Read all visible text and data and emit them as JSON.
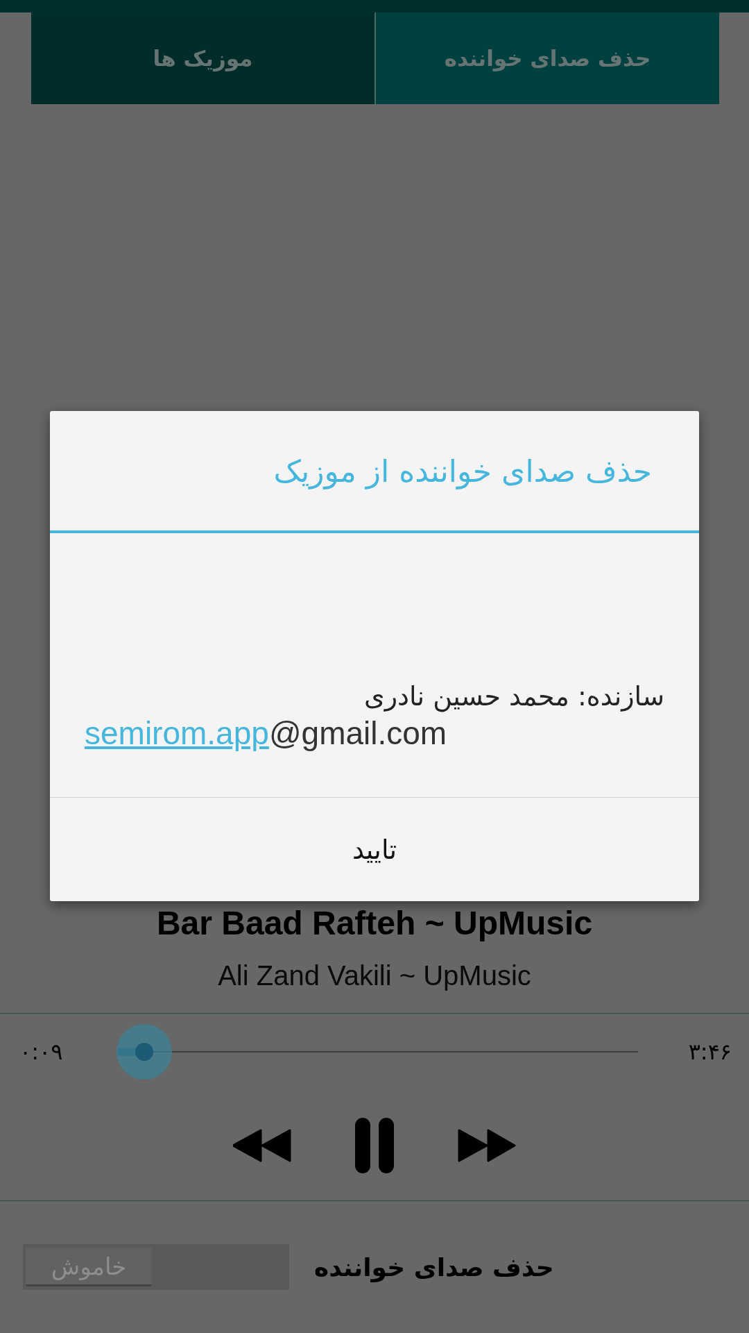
{
  "tabs": [
    {
      "label": "حذف صدای خواننده",
      "selected": true
    },
    {
      "label": "موزیک ها",
      "selected": false
    }
  ],
  "player": {
    "title": "Bar Baad Rafteh ~ UpMusic",
    "artist": "Ali Zand Vakili  ~ UpMusic",
    "elapsed": "۰:۰۹",
    "duration": "۳:۴۶",
    "level": 0.05,
    "playing": true
  },
  "vocal_removal": {
    "label": "حذف صدای خواننده",
    "switch": {
      "label": "خاموش",
      "on": false
    }
  },
  "dialog": {
    "title": "حذف صدای خواننده از موزیک",
    "creator": "سازنده: محمد حسین نادری",
    "email_link": "semirom.app",
    "email_rest": "@gmail.com",
    "button": "تایید"
  }
}
